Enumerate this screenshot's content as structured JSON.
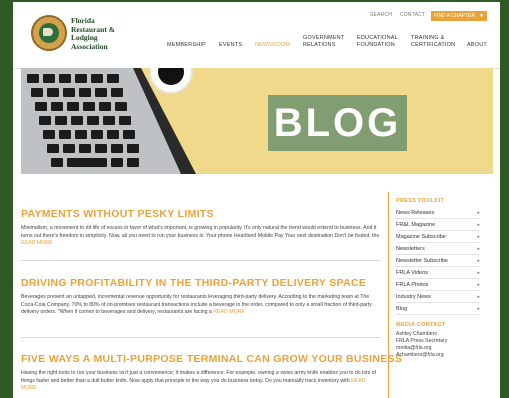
{
  "header": {
    "logo_text": "Florida\nRestaurant &\nLodging\nAssociation",
    "utility": [
      "SEARCH",
      "CONTACT"
    ],
    "find_chapter": "FIND A CHAPTER",
    "nav": [
      {
        "label": "MEMBERSHIP",
        "active": false
      },
      {
        "label": "EVENTS",
        "active": false
      },
      {
        "label": "NEWSROOM",
        "active": true
      },
      {
        "label": "GOVERNMENT\nRELATIONS",
        "active": false
      },
      {
        "label": "EDUCATIONAL\nFOUNDATION",
        "active": false
      },
      {
        "label": "TRAINING &\nCERTIFICATION",
        "active": false
      },
      {
        "label": "ABOUT",
        "active": false
      }
    ]
  },
  "hero": {
    "title": "BLOG"
  },
  "articles": [
    {
      "title": "PAYMENTS WITHOUT PESKY LIMITS",
      "excerpt": "Minimalism, a movement to rid life of excess in favor of what's important, is growing in popularity. It's only natural the trend would extend to business. And it turns out there's freedom in simplicity. Now, all you need to run your business is: Your phone Heartland Mobile Pay Your next destination Don't be fooled; the",
      "read_more": "READ MORE"
    },
    {
      "title": "DRIVING PROFITABILITY IN THE THIRD-PARTY DELIVERY SPACE",
      "excerpt": "Beverages present an untapped, incremental revenue opportunity for restaurants leveraging third-party delivery. According to the marketing team at The Coca-Cola Company, 70% to 80% of on-premises restaurant transactions include a beverage in the order, compared to only a small fraction of third-party delivery orders. \"When it comes to beverages and delivery, restaurants are facing a",
      "read_more": "READ MORE"
    },
    {
      "title": "FIVE WAYS A MULTI-PURPOSE TERMINAL CAN GROW YOUR BUSINESS",
      "excerpt": "Having the right tools to run your business isn't just a convenience; it makes a difference. For example, owning a swiss army knife enables you to do lots of things faster and better than a dull butter knife. Now apply that principle to the way you do business today. Do you manually track inventory with",
      "read_more": "READ MORE"
    }
  ],
  "sidebar": {
    "toolkit_heading": "PRESS TOOLKIT",
    "toolkit_items": [
      "News Releases",
      "FR&L Magazine",
      "Magazine Subscribe",
      "Newsletters",
      "Newsletter Subscribe",
      "FRLA Videos",
      "FRLA Photos",
      "Industry News",
      "Blog"
    ],
    "contact_heading": "MEDIA CONTACT",
    "contact_lines": [
      "Ashley Chambers",
      "FRLA Press Secretary",
      "media@frla.org",
      "Achambers@frla.org"
    ]
  },
  "colors": {
    "accent": "#e8a33a",
    "frame": "#2e5b23",
    "hero_bg": "#f0d98a",
    "blog_box": "#839d72"
  }
}
